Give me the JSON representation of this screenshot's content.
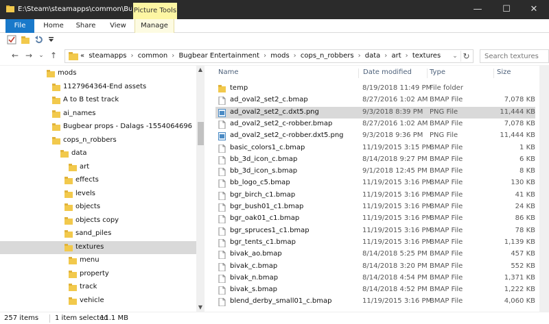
{
  "window": {
    "title_path": "E:\\Steam\\steamapps\\common\\Bug...",
    "context_tab": "Picture Tools"
  },
  "ribbon": {
    "tabs": [
      "File",
      "Home",
      "Share",
      "View",
      "Manage"
    ]
  },
  "address": {
    "crumbs": [
      "«",
      "steamapps",
      "common",
      "Bugbear Entertainment",
      "mods",
      "cops_n_robbers",
      "data",
      "art",
      "textures"
    ]
  },
  "search": {
    "placeholder": "Search textures"
  },
  "nav_tree": [
    {
      "label": "mods",
      "level": 0
    },
    {
      "label": "1127964364-End assets",
      "level": 1
    },
    {
      "label": "A to B test track",
      "level": 1
    },
    {
      "label": "ai_names",
      "level": 1
    },
    {
      "label": "Bugbear props - Dalags -1554064696",
      "level": 1
    },
    {
      "label": "cops_n_robbers",
      "level": 1
    },
    {
      "label": "data",
      "level": 2
    },
    {
      "label": "art",
      "level": 3
    },
    {
      "label": "effects",
      "level": 4
    },
    {
      "label": "levels",
      "level": 4
    },
    {
      "label": "objects",
      "level": 4
    },
    {
      "label": "objects copy",
      "level": 4
    },
    {
      "label": "sand_piles",
      "level": 4
    },
    {
      "label": "textures",
      "level": 4,
      "selected": true
    },
    {
      "label": "menu",
      "level": 3
    },
    {
      "label": "property",
      "level": 3
    },
    {
      "label": "track",
      "level": 3
    },
    {
      "label": "vehicle",
      "level": 3
    }
  ],
  "columns": {
    "name": "Name",
    "date": "Date modified",
    "type": "Type",
    "size": "Size"
  },
  "files": [
    {
      "name": "temp",
      "date": "8/19/2018 11:49 PM",
      "type": "File folder",
      "size": "",
      "icon": "folder"
    },
    {
      "name": "ad_oval2_set2_c.bmap",
      "date": "8/27/2016 1:02 AM",
      "type": "BMAP File",
      "size": "7,078 KB",
      "icon": "file"
    },
    {
      "name": "ad_oval2_set2_c.dxt5.png",
      "date": "9/3/2018 8:39 PM",
      "type": "PNG File",
      "size": "11,444 KB",
      "icon": "image",
      "selected": true
    },
    {
      "name": "ad_oval2_set2_c-robber.bmap",
      "date": "8/27/2016 1:02 AM",
      "type": "BMAP File",
      "size": "7,078 KB",
      "icon": "file"
    },
    {
      "name": "ad_oval2_set2_c-robber.dxt5.png",
      "date": "9/3/2018 9:36 PM",
      "type": "PNG File",
      "size": "11,444 KB",
      "icon": "image"
    },
    {
      "name": "basic_colors1_c.bmap",
      "date": "11/19/2015 3:15 PM",
      "type": "BMAP File",
      "size": "1 KB",
      "icon": "file"
    },
    {
      "name": "bb_3d_icon_c.bmap",
      "date": "8/14/2018 9:27 PM",
      "type": "BMAP File",
      "size": "6 KB",
      "icon": "file"
    },
    {
      "name": "bb_3d_icon_s.bmap",
      "date": "9/1/2018 12:45 PM",
      "type": "BMAP File",
      "size": "8 KB",
      "icon": "file"
    },
    {
      "name": "bb_logo_c5.bmap",
      "date": "11/19/2015 3:16 PM",
      "type": "BMAP File",
      "size": "130 KB",
      "icon": "file"
    },
    {
      "name": "bgr_birch_c1.bmap",
      "date": "11/19/2015 3:16 PM",
      "type": "BMAP File",
      "size": "41 KB",
      "icon": "file"
    },
    {
      "name": "bgr_bush01_c1.bmap",
      "date": "11/19/2015 3:16 PM",
      "type": "BMAP File",
      "size": "24 KB",
      "icon": "file"
    },
    {
      "name": "bgr_oak01_c1.bmap",
      "date": "11/19/2015 3:16 PM",
      "type": "BMAP File",
      "size": "86 KB",
      "icon": "file"
    },
    {
      "name": "bgr_spruces1_c1.bmap",
      "date": "11/19/2015 3:16 PM",
      "type": "BMAP File",
      "size": "78 KB",
      "icon": "file"
    },
    {
      "name": "bgr_tents_c1.bmap",
      "date": "11/19/2015 3:16 PM",
      "type": "BMAP File",
      "size": "1,139 KB",
      "icon": "file"
    },
    {
      "name": "bivak_ao.bmap",
      "date": "8/14/2018 5:25 PM",
      "type": "BMAP File",
      "size": "457 KB",
      "icon": "file"
    },
    {
      "name": "bivak_c.bmap",
      "date": "8/14/2018 3:20 PM",
      "type": "BMAP File",
      "size": "552 KB",
      "icon": "file"
    },
    {
      "name": "bivak_n.bmap",
      "date": "8/14/2018 4:54 PM",
      "type": "BMAP File",
      "size": "1,371 KB",
      "icon": "file"
    },
    {
      "name": "bivak_s.bmap",
      "date": "8/14/2018 4:52 PM",
      "type": "BMAP File",
      "size": "1,222 KB",
      "icon": "file"
    },
    {
      "name": "blend_derby_small01_c.bmap",
      "date": "11/19/2015 3:16 PM",
      "type": "BMAP File",
      "size": "4,060 KB",
      "icon": "file"
    }
  ],
  "status": {
    "items_count": "257 items",
    "selected": "1 item selected",
    "size": "11.1 MB"
  },
  "colors": {
    "file_tab": "#1979ca",
    "context_tab": "#fdf6a3",
    "folder": "#f2c94c",
    "selection": "#d9d9d9"
  }
}
